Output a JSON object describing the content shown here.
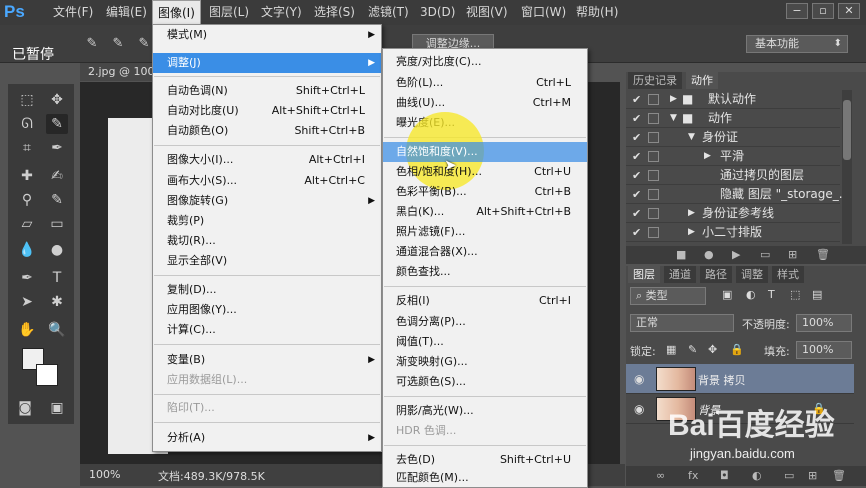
{
  "menubar": {
    "logo": "Ps",
    "items": [
      "文件(F)",
      "编辑(E)",
      "图像(I)",
      "图层(L)",
      "文字(Y)",
      "选择(S)",
      "滤镜(T)",
      "3D(D)",
      "视图(V)",
      "窗口(W)",
      "帮助(H)"
    ],
    "active_index": 2
  },
  "options_bar": {
    "paused": "已暂停",
    "adjust_edge": "调整边缘...",
    "workspace": "基本功能"
  },
  "document": {
    "tab_title": "2.jpg @ 100",
    "zoom": "100%",
    "doc_size": "文档:489.3K/978.5K"
  },
  "image_menu": {
    "items": [
      {
        "label": "模式(M)",
        "submenu": true
      },
      {
        "label": "调整(J)",
        "submenu": true,
        "highlight": true
      },
      {
        "label": "自动色调(N)",
        "shortcut": "Shift+Ctrl+L"
      },
      {
        "label": "自动对比度(U)",
        "shortcut": "Alt+Shift+Ctrl+L"
      },
      {
        "label": "自动颜色(O)",
        "shortcut": "Shift+Ctrl+B"
      },
      {
        "label": "图像大小(I)...",
        "shortcut": "Alt+Ctrl+I"
      },
      {
        "label": "画布大小(S)...",
        "shortcut": "Alt+Ctrl+C"
      },
      {
        "label": "图像旋转(G)",
        "submenu": true
      },
      {
        "label": "裁剪(P)"
      },
      {
        "label": "裁切(R)..."
      },
      {
        "label": "显示全部(V)"
      },
      {
        "label": "复制(D)..."
      },
      {
        "label": "应用图像(Y)..."
      },
      {
        "label": "计算(C)..."
      },
      {
        "label": "变量(B)",
        "submenu": true
      },
      {
        "label": "应用数据组(L)...",
        "disabled": true
      },
      {
        "label": "陷印(T)...",
        "disabled": true
      },
      {
        "label": "分析(A)",
        "submenu": true
      }
    ]
  },
  "adjust_menu": {
    "items": [
      {
        "label": "亮度/对比度(C)..."
      },
      {
        "label": "色阶(L)...",
        "shortcut": "Ctrl+L"
      },
      {
        "label": "曲线(U)...",
        "shortcut": "Ctrl+M"
      },
      {
        "label": "曝光度(E)..."
      },
      {
        "label": "自然饱和度(V)...",
        "highlight": true
      },
      {
        "label": "色相/饱和度(H)...",
        "shortcut": "Ctrl+U"
      },
      {
        "label": "色彩平衡(B)...",
        "shortcut": "Ctrl+B"
      },
      {
        "label": "黑白(K)...",
        "shortcut": "Alt+Shift+Ctrl+B"
      },
      {
        "label": "照片滤镜(F)..."
      },
      {
        "label": "通道混合器(X)..."
      },
      {
        "label": "颜色查找..."
      },
      {
        "label": "反相(I)",
        "shortcut": "Ctrl+I"
      },
      {
        "label": "色调分离(P)..."
      },
      {
        "label": "阈值(T)..."
      },
      {
        "label": "渐变映射(G)..."
      },
      {
        "label": "可选颜色(S)..."
      },
      {
        "label": "阴影/高光(W)..."
      },
      {
        "label": "HDR 色调...",
        "disabled": true
      },
      {
        "label": "去色(D)",
        "shortcut": "Shift+Ctrl+U"
      },
      {
        "label": "匹配颜色(M)..."
      }
    ]
  },
  "history_panel": {
    "tabs": [
      "历史记录",
      "动作"
    ],
    "actions": [
      "默认动作",
      "动作",
      "身份证",
      "平滑",
      "通过拷贝的图层",
      "隐藏 图层 \"_storage_...",
      "身份证参考线",
      "小二寸排版"
    ]
  },
  "layers_panel": {
    "tabs": [
      "图层",
      "通道",
      "路径",
      "调整",
      "样式"
    ],
    "filter_kind": "类型",
    "blend_mode": "正常",
    "opacity_label": "不透明度:",
    "opacity_value": "100%",
    "lock_label": "锁定:",
    "fill_label": "填充:",
    "fill_value": "100%",
    "layers": [
      {
        "name": "背景 拷贝",
        "selected": true
      },
      {
        "name": "背景",
        "locked": true
      }
    ]
  },
  "watermark": {
    "logo": "Bai百度经验",
    "url": "jingyan.baidu.com"
  },
  "colors": {
    "menu_highlight": "#3a8ee6",
    "cursor_glow": "#f7e828",
    "layer_selected": "#6c7c96"
  }
}
